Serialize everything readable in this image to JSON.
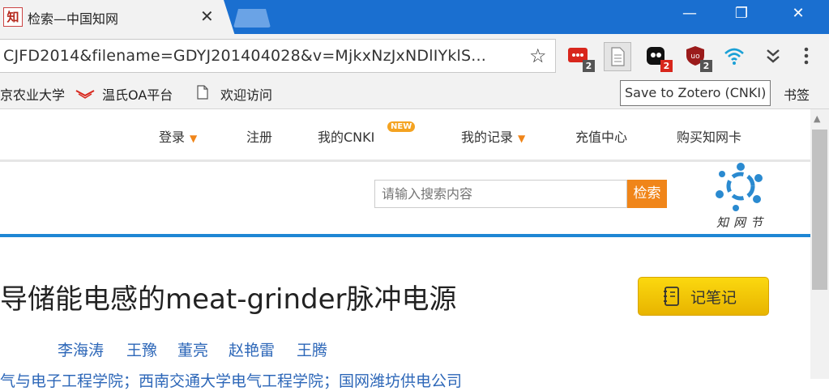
{
  "browser": {
    "tab_title": "检索—中国知网",
    "tab_favicon_char": "知",
    "close_tab": "✕",
    "url": "CJFD2014&filename=GDYJ201404028&v=MjkxNzJxNDlIYklS...",
    "bookmark_star": "☆",
    "window_controls": {
      "minimize": "—",
      "restore": "❐",
      "close": "✕"
    },
    "extensions": [
      {
        "name": "ext-red-dots-icon",
        "badge": "2",
        "color": "#d8261c"
      },
      {
        "name": "zotero-page-icon",
        "badge": "",
        "color": "#888888"
      },
      {
        "name": "ghostery-icon",
        "badge": "2",
        "color": "#111111"
      },
      {
        "name": "ublock-icon",
        "badge": "2",
        "color": "#9b1b1b"
      },
      {
        "name": "wifi-icon",
        "badge": "",
        "color": "#1aa0d6"
      },
      {
        "name": "expand-icon",
        "badge": "",
        "color": "#444444"
      },
      {
        "name": "menu-dots-icon",
        "badge": "",
        "color": "#444444"
      }
    ],
    "bookmarks": [
      {
        "label": "京农业大学",
        "icon": "none"
      },
      {
        "label": "温氏OA平台",
        "icon": "wens-logo-icon"
      },
      {
        "label": "欢迎访问",
        "icon": "page-icon"
      },
      {
        "label": "书签",
        "icon": "none"
      }
    ],
    "tooltip": "Save to Zotero (CNKI)"
  },
  "page": {
    "nav": {
      "login": "登录",
      "register": "注册",
      "my_cnki": "我的CNKI",
      "new_badge": "NEW",
      "my_records": "我的记录",
      "recharge": "充值中心",
      "buy_card": "购买知网卡"
    },
    "search": {
      "placeholder": "请输入搜索内容",
      "button": "检索"
    },
    "festival_logo_text": "知网节",
    "title": "导储能电感的meat-grinder脉冲电源",
    "note_button": "记笔记",
    "authors": [
      "李海涛",
      "王豫",
      "董亮",
      "赵艳雷",
      "王腾"
    ],
    "affiliation": "气与电子工程学院；西南交通大学电气工程学院；国网潍坊供电公司"
  },
  "colors": {
    "titlebar": "#1a6fd0",
    "accent_orange": "#f08519",
    "link_blue": "#2d67b8",
    "divider_blue": "#1e86d4",
    "note_yellow": "#f5c800"
  }
}
